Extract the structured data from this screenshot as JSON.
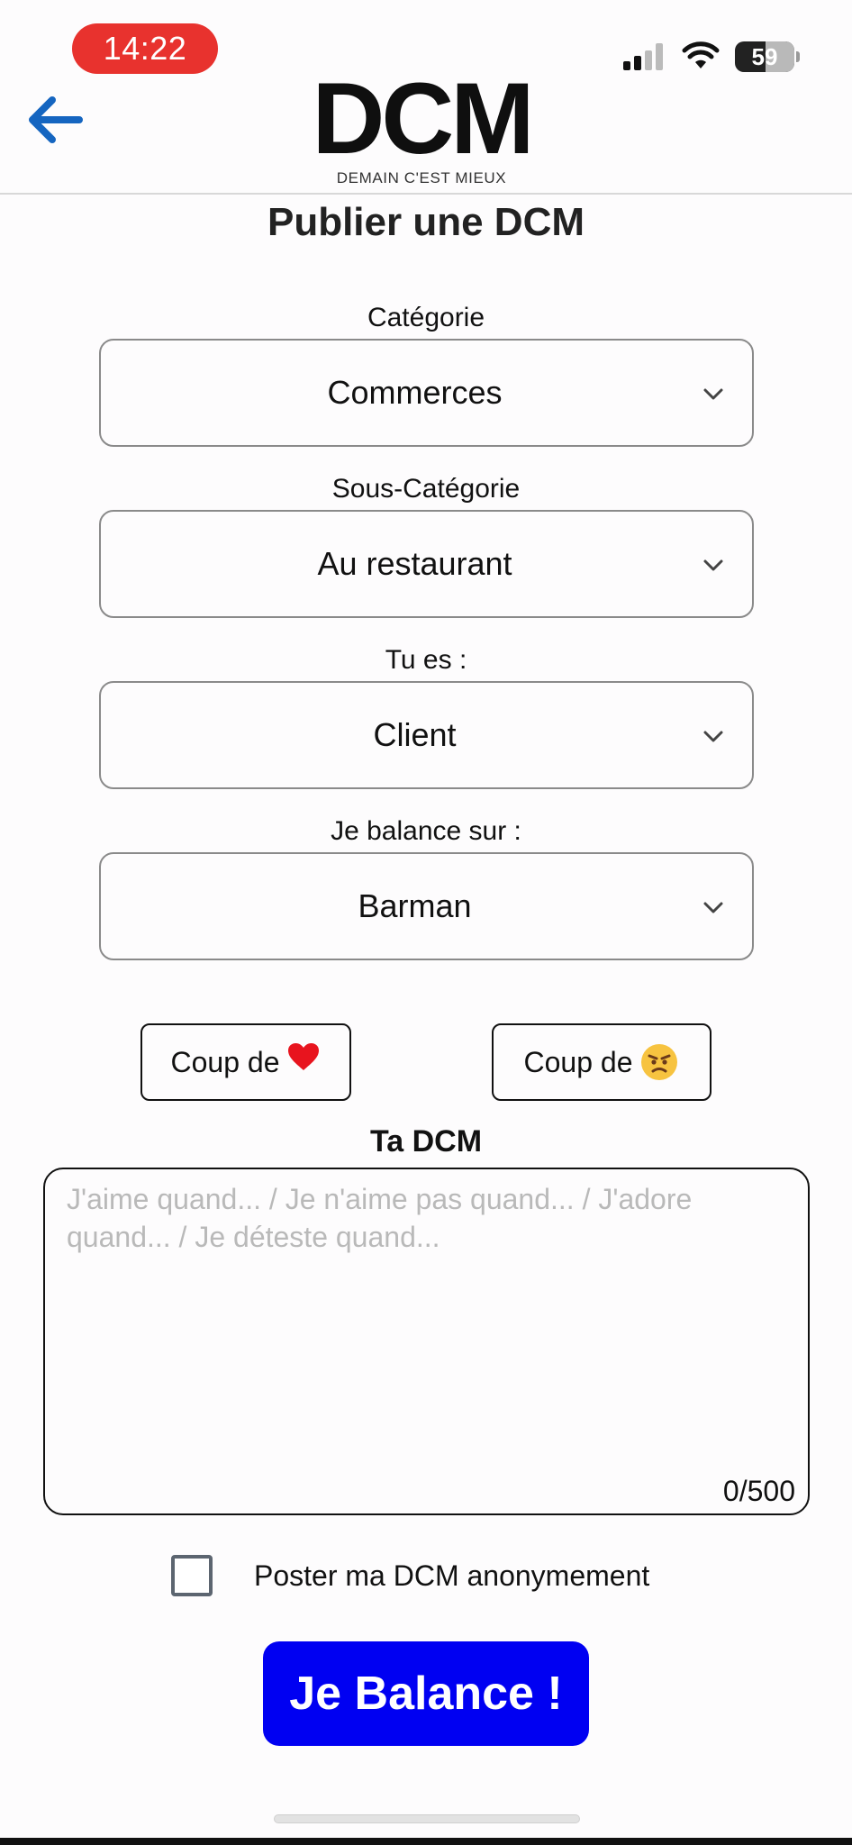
{
  "status_bar": {
    "time": "14:22",
    "battery": "59"
  },
  "header": {
    "back_icon": "arrow-left-icon",
    "logo_title": "DCM",
    "logo_subtitle": "DEMAIN C'EST MIEUX"
  },
  "page_title": "Publier une DCM",
  "fields": [
    {
      "label": "Catégorie",
      "value": "Commerces"
    },
    {
      "label": "Sous-Catégorie",
      "value": "Au restaurant"
    },
    {
      "label": "Tu es :",
      "value": "Client"
    },
    {
      "label": "Je balance sur :",
      "value": "Barman"
    }
  ],
  "coup_buttons": [
    {
      "label": "Coup de",
      "icon": "heart-icon"
    },
    {
      "label": "Coup de",
      "icon": "angry-face-icon"
    }
  ],
  "textarea": {
    "label": "Ta DCM",
    "placeholder": "J'aime quand... / Je n'aime pas quand... / J'adore quand... / Je déteste quand...",
    "count": "0/500"
  },
  "anonymous": {
    "label": "Poster ma DCM anonymement",
    "checked": false
  },
  "submit_label": "Je Balance !",
  "colors": {
    "accent_blue": "#0000f2",
    "back_arrow": "#1565c0",
    "time_pill": "#e8322e"
  }
}
